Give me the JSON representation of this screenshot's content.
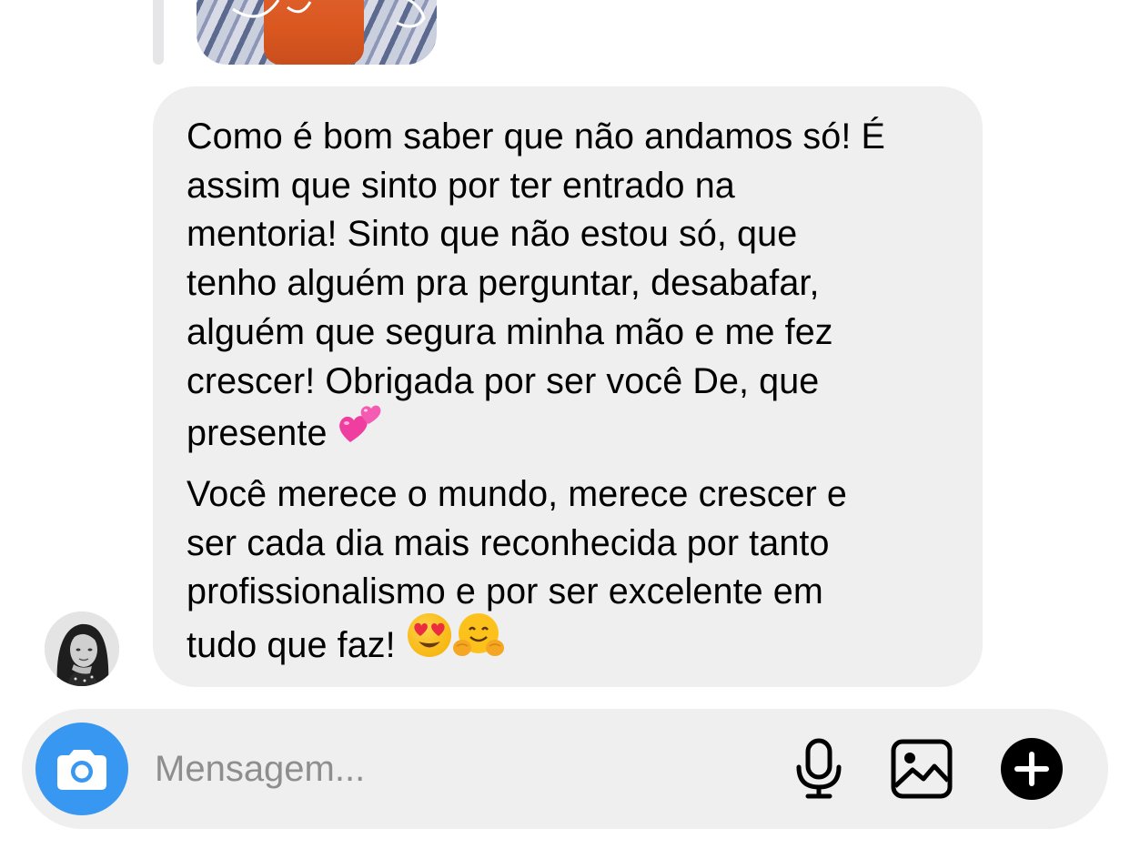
{
  "conversation": {
    "message": {
      "paragraph_1": "Como é bom saber que não andamos só! É\nassim que sinto por ter entrado na\nmentoria! Sinto que não estou só, que\ntenho alguém pra perguntar, desabafar,\nalguém que segura minha mão e me fez\ncrescer! Obrigada por ser você De, que\npresente",
      "paragraph_2": "Você merece o mundo, merece crescer e\nser cada dia mais reconhecida por tanto\nprofissionalismo e por ser excelente em\ntudo que faz!",
      "paragraph_1_emoji": "two-hearts-emoji",
      "paragraph_2_emojis": [
        "heart-eyes-emoji",
        "hugging-face-emoji"
      ]
    },
    "sender_avatar": "avatar-photo"
  },
  "composer": {
    "placeholder": "Mensagem...",
    "camera_icon": "camera-icon",
    "mic_icon": "microphone-icon",
    "gallery_icon": "gallery-icon",
    "add_icon": "plus-circle-icon"
  },
  "colors": {
    "bubble_background": "#efefef",
    "composer_background": "#efefef",
    "camera_button": "#3897f0",
    "placeholder_text": "#8e8e8e",
    "message_text": "#000000"
  }
}
